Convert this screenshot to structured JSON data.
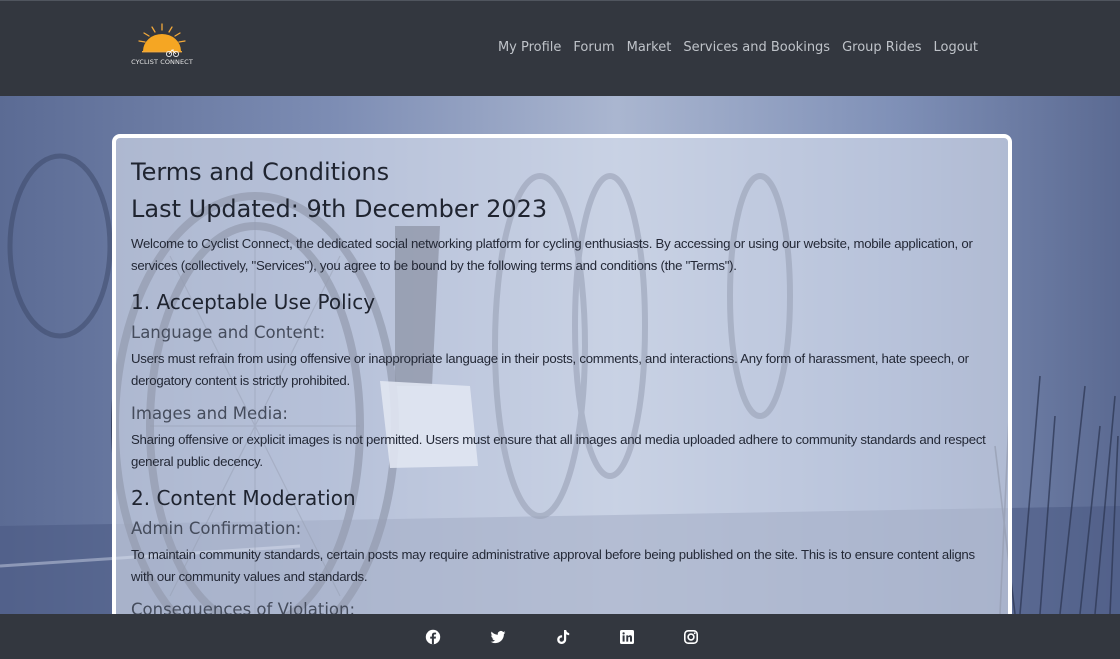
{
  "brand": {
    "logo_text": "CYCLIST CONNECT",
    "accent": "#f2a93b"
  },
  "nav": [
    {
      "label": "My Profile",
      "name": "nav-my-profile"
    },
    {
      "label": "Forum",
      "name": "nav-forum"
    },
    {
      "label": "Market",
      "name": "nav-market"
    },
    {
      "label": "Services and Bookings",
      "name": "nav-services-bookings"
    },
    {
      "label": "Group Rides",
      "name": "nav-group-rides"
    },
    {
      "label": "Logout",
      "name": "nav-logout"
    }
  ],
  "terms": {
    "title": "Terms and Conditions",
    "updated": "Last Updated: 9th December 2023",
    "intro": "Welcome to Cyclist Connect, the dedicated social networking platform for cycling enthusiasts. By accessing or using our website, mobile application, or services (collectively, \"Services\"), you agree to be bound by the following terms and conditions (the \"Terms\").",
    "section1": {
      "heading": "1. Acceptable Use Policy",
      "sub1": "Language and Content:",
      "text1": "Users must refrain from using offensive or inappropriate language in their posts, comments, and interactions. Any form of harassment, hate speech, or derogatory content is strictly prohibited.",
      "sub2": "Images and Media:",
      "text2": "Sharing offensive or explicit images is not permitted. Users must ensure that all images and media uploaded adhere to community standards and respect general public decency."
    },
    "section2": {
      "heading": "2. Content Moderation",
      "sub1": "Admin Confirmation:",
      "text1": "To maintain community standards, certain posts may require administrative approval before being published on the site. This is to ensure content aligns with our community values and standards.",
      "sub2": "Consequences of Violation:"
    }
  },
  "footer": {
    "icons": [
      "facebook-icon",
      "twitter-icon",
      "tiktok-icon",
      "linkedin-icon",
      "instagram-icon"
    ]
  }
}
